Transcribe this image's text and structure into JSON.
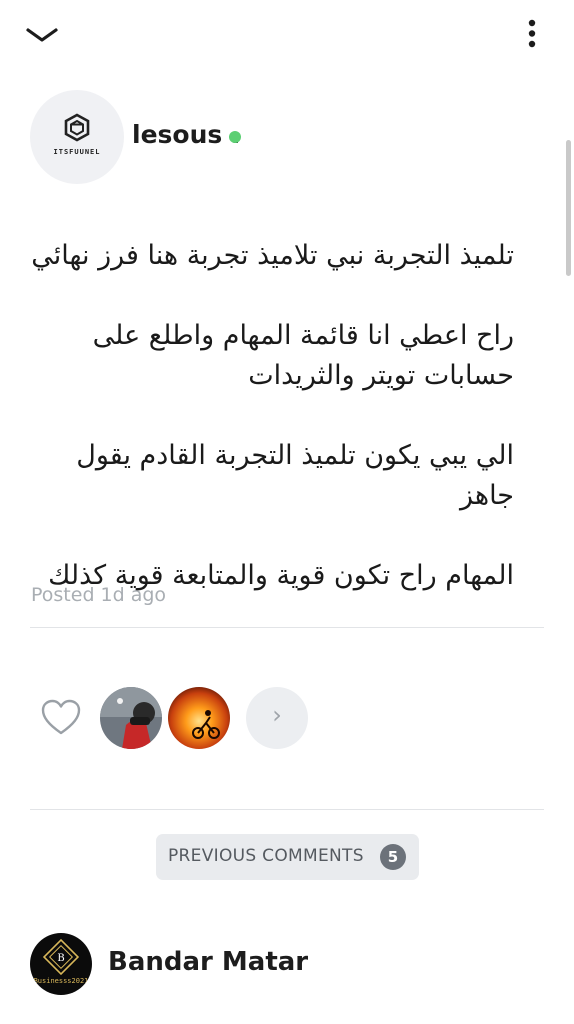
{
  "header": {
    "collapse_icon": "chevron-down-icon",
    "menu_icon": "more-vertical-icon"
  },
  "post": {
    "author": {
      "name": "lesous .",
      "avatar_brand": "ITSFUUNEL",
      "status": "online",
      "status_color": "#5ccf73"
    },
    "paragraphs": [
      "تلميذ التجربة نبي تلاميذ تجربة هنا فرز نهائي",
      "راح اعطي انا قائمة المهام واطلع على حسابات تويتر والثريدات",
      "الي يبي يكون تلميذ التجربة القادم يقول جاهز",
      "المهام راح تكون قوية والمتابعة قوية كذلك"
    ],
    "posted": "Posted 1d ago"
  },
  "likes": {
    "heart_icon": "heart-outline-icon",
    "more_icon": "chevron-right-icon",
    "more_label": "›"
  },
  "comments": {
    "previous_label": "PREVIOUS COMMENTS",
    "previous_count": "5",
    "items": [
      {
        "name": "Bandar Matar",
        "avatar_text": "Businesss2021",
        "avatar_letter": "B"
      }
    ]
  },
  "colors": {
    "accent_online": "#5ccf73",
    "muted_text": "#a9aeb3",
    "badge_bg": "#6c727a"
  }
}
